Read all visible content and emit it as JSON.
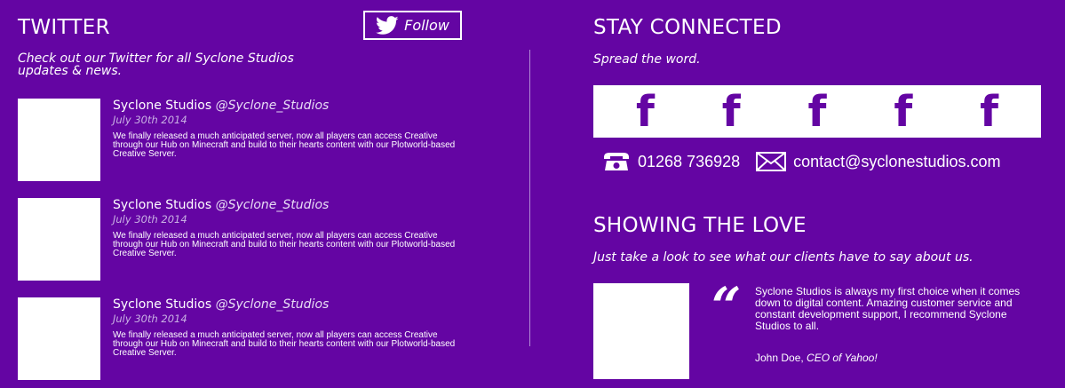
{
  "twitter": {
    "title": "TWITTER",
    "follow_label": "Follow",
    "subtitle": "Check out our Twitter for all Syclone Studios updates & news.",
    "tweets": [
      {
        "name": "Syclone Studios",
        "handle": "@Syclone_Studios",
        "date": "July 30th 2014",
        "text": "We finally released a much anticipated server, now all players can access Creative through our Hub on Minecraft and build to their hearts content with our Plotworld-based Creative Server."
      },
      {
        "name": "Syclone Studios",
        "handle": "@Syclone_Studios",
        "date": "July 30th 2014",
        "text": "We finally released a much anticipated server, now all players can access Creative through our Hub on Minecraft and build to their hearts content with our Plotworld-based Creative Server."
      },
      {
        "name": "Syclone Studios",
        "handle": "@Syclone_Studios",
        "date": "July 30th 2014",
        "text": "We finally released a much anticipated server, now all players can access Creative through our Hub on Minecraft and build to their hearts content with our Plotworld-based Creative Server."
      }
    ]
  },
  "connected": {
    "title": "STAY CONNECTED",
    "subtitle": "Spread the word.",
    "share_icons": [
      "f",
      "f",
      "f",
      "f",
      "f"
    ],
    "phone": "01268 736928",
    "email": "contact@syclonestudios.com"
  },
  "love": {
    "title": "SHOWING THE LOVE",
    "subtitle": "Just take a look to see what our clients have to say about us.",
    "quote": "Syclone Studios is always my first choice when it comes down to digital content. Amazing customer service and constant development support, I recommend Syclone Studios to all.",
    "author": "John Doe,",
    "author_role": "CEO of Yahoo!"
  },
  "colors": {
    "background": "#6405a3",
    "panel": "#ffffff"
  }
}
